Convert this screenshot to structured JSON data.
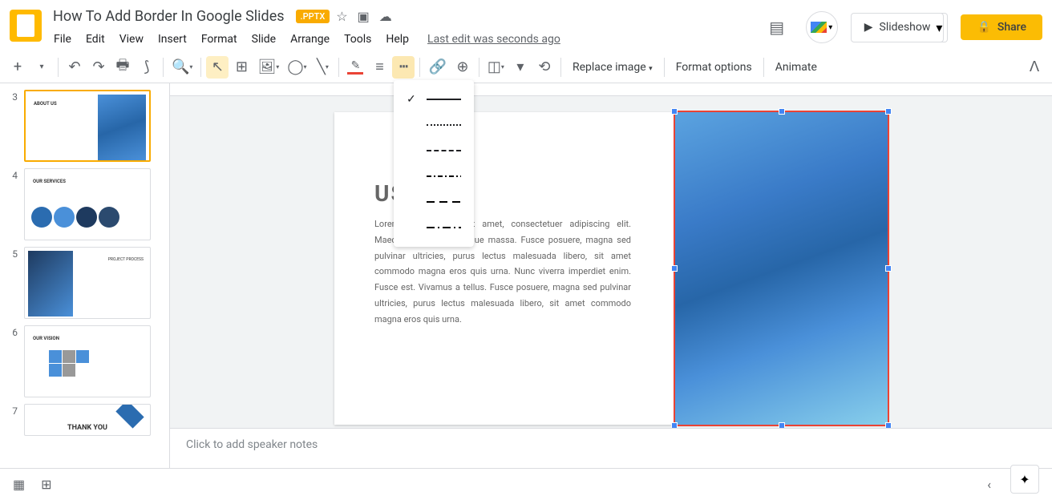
{
  "header": {
    "title": "How To Add Border In Google Slides",
    "badge": ".PPTX",
    "menu": [
      "File",
      "Edit",
      "View",
      "Insert",
      "Format",
      "Slide",
      "Arrange",
      "Tools",
      "Help"
    ],
    "last_edit": "Last edit was seconds ago",
    "slideshow": "Slideshow",
    "share": "Share"
  },
  "toolbar": {
    "replace_image": "Replace image",
    "format_options": "Format options",
    "animate": "Animate"
  },
  "filmstrip": {
    "visible_start": 3,
    "slides": [
      {
        "num": "3",
        "title": "ABOUT US",
        "active": true
      },
      {
        "num": "4",
        "title": "OUR SERVICES"
      },
      {
        "num": "5",
        "title": "PROJECT PROCESS"
      },
      {
        "num": "6",
        "title": "OUR VISION"
      },
      {
        "num": "7",
        "title": "THANK YOU"
      }
    ]
  },
  "slide": {
    "title_visible": "US",
    "body": "Lorem ipsum dolor sit amet, consectetuer adipiscing elit. Maecenas porttitor congue massa. Fusce posuere, magna sed pulvinar ultricies, purus lectus malesuada libero, sit amet commodo magna eros quis urna. Nunc viverra imperdiet enim. Fusce est. Vivamus a tellus. Fusce posuere, magna sed pulvinar ultricies, purus lectus malesuada libero, sit amet commodo magna eros quis urna."
  },
  "border_dash_menu": {
    "options": [
      {
        "style": "solid",
        "selected": true
      },
      {
        "style": "dotted",
        "selected": false
      },
      {
        "style": "dashed",
        "selected": false
      },
      {
        "style": "dash-dot",
        "selected": false
      },
      {
        "style": "long-dash",
        "selected": false
      },
      {
        "style": "long-dash-dot",
        "selected": false
      }
    ]
  },
  "notes": {
    "placeholder": "Click to add speaker notes"
  }
}
